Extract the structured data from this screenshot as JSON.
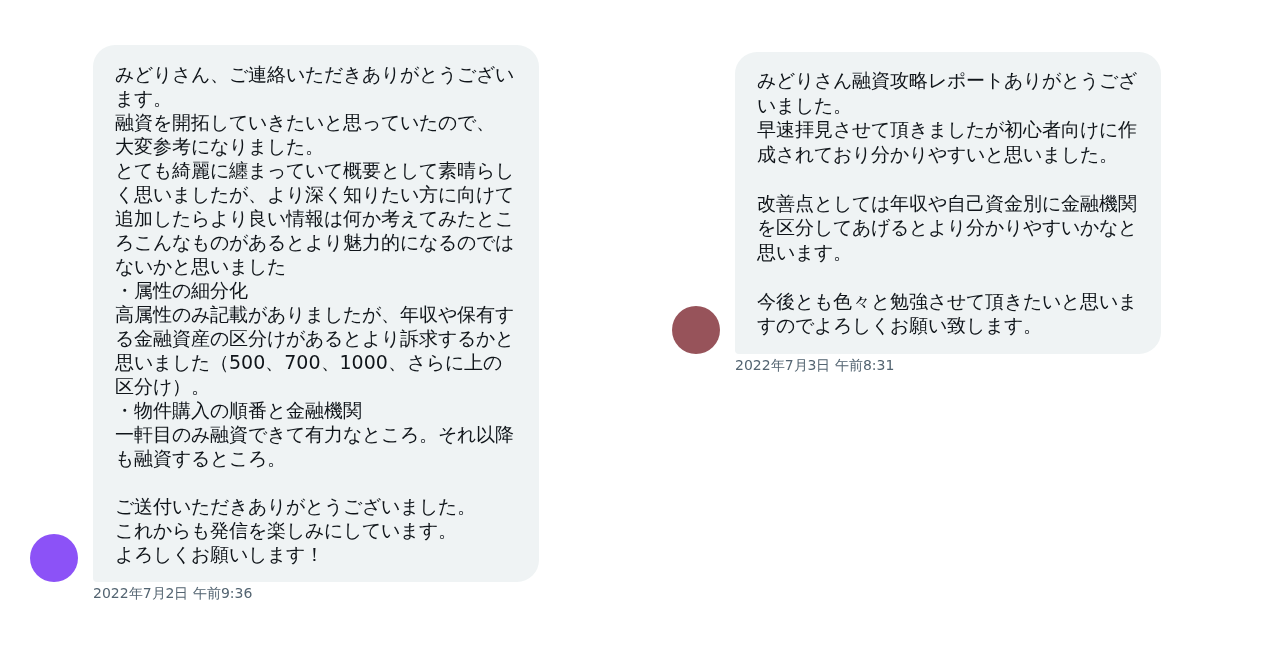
{
  "messages": [
    {
      "blocks": [
        [
          "みどりさん、ご連絡いただきありがとうございます。",
          "融資を開拓していきたいと思っていたので、",
          "大変参考になりました。",
          "とても綺麗に纏まっていて概要として素晴らしく思いましたが、より深く知りたい方に向けて追加したらより良い情報は何か考えてみたところこんなものがあるとより魅力的になるのではないかと思いました",
          "・属性の細分化",
          "高属性のみ記載がありましたが、年収や保有する金融資産の区分けがあるとより訴求するかと思いました（500、700、1000、さらに上の区分け）。",
          "・物件購入の順番と金融機関",
          "一軒目のみ融資できて有力なところ。それ以降も融資するところ。"
        ],
        [
          "ご送付いただきありがとうございました。",
          "これからも発信を楽しみにしています。",
          "よろしくお願いします！"
        ]
      ],
      "time": "2022年7月2日 午前9:36",
      "color": "#8c52f7"
    },
    {
      "blocks": [
        [
          "みどりさん融資攻略レポートありがとうございました。",
          "早速拝見させて頂きましたが初心者向けに作成されており分かりやすいと思いました。"
        ],
        [
          "改善点としては年収や自己資金別に金融機関を区分してあげるとより分かりやすいかなと思います。"
        ],
        [
          "今後とも色々と勉強させて頂きたいと思いますのでよろしくお願い致します。"
        ]
      ],
      "time": "2022年7月3日 午前8:31",
      "color": "#97535a"
    }
  ]
}
